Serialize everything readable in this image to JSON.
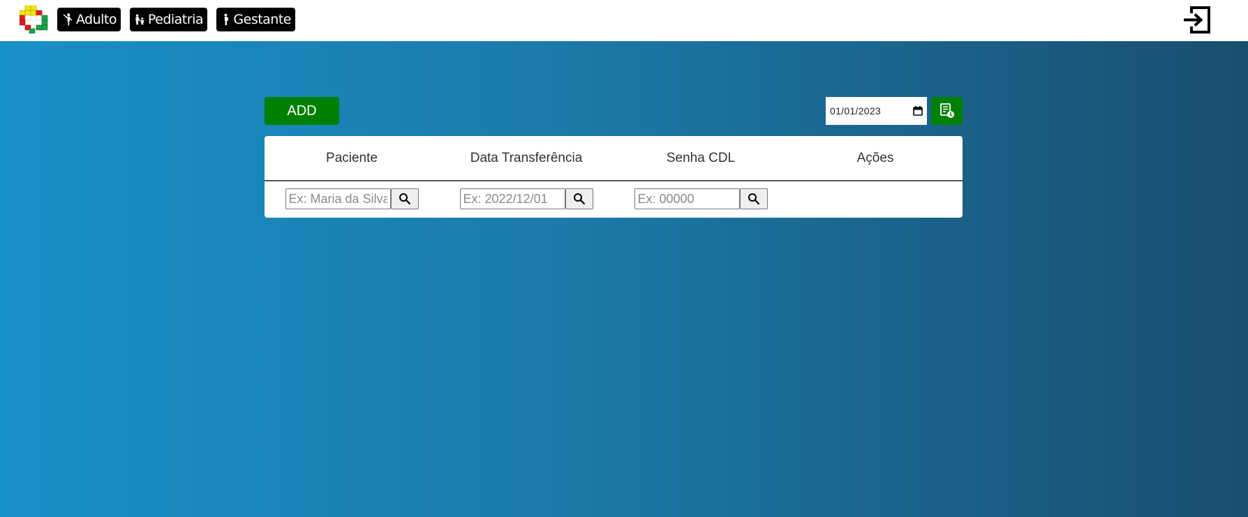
{
  "nav": {
    "adulto_label": "Adulto",
    "pediatria_label": "Pediatria",
    "gestante_label": "Gestante"
  },
  "toolbar": {
    "add_label": "ADD",
    "date_value": "01/01/2023"
  },
  "table": {
    "headers": [
      "Paciente",
      "Data Transferência",
      "Senha CDL",
      "Ações"
    ],
    "filters": [
      {
        "placeholder": "Ex: Maria da Silva"
      },
      {
        "placeholder": "Ex: 2022/12/01"
      },
      {
        "placeholder": "Ex: 00000"
      }
    ]
  },
  "colors": {
    "accent_green": "#008000",
    "nav_black": "#000000",
    "gradient_start": "#1890c8",
    "gradient_end": "#1a4e6e"
  },
  "icons": [
    "hospital-logo-icon",
    "adult-person-icon",
    "family-icon",
    "pregnant-woman-icon",
    "logout-icon",
    "calendar-icon",
    "report-icon",
    "search-icon"
  ]
}
